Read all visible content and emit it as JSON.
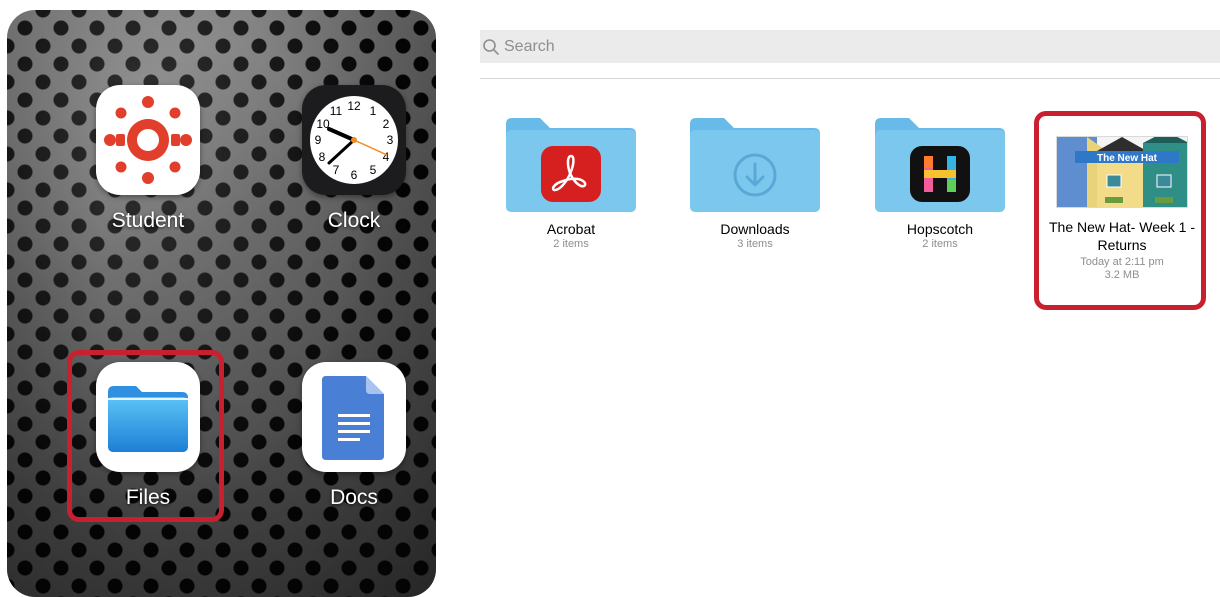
{
  "home": {
    "apps": [
      {
        "label": "Student",
        "icon": "canvas-student-icon"
      },
      {
        "label": "Clock",
        "icon": "clock-icon"
      },
      {
        "label": "Files",
        "icon": "files-folder-icon"
      },
      {
        "label": "Docs",
        "icon": "google-docs-icon"
      }
    ],
    "clock_numbers": [
      "12",
      "1",
      "2",
      "3",
      "4",
      "5",
      "6",
      "7",
      "8",
      "9",
      "10",
      "11"
    ]
  },
  "search": {
    "placeholder": "Search"
  },
  "files": {
    "items": [
      {
        "name": "Acrobat",
        "meta": "2 items",
        "icon": "acrobat-icon"
      },
      {
        "name": "Downloads",
        "meta": "3 items",
        "icon": "download-arrow-icon"
      },
      {
        "name": "Hopscotch",
        "meta": "2 items",
        "icon": "hopscotch-icon"
      },
      {
        "name": "The New Hat- Week 1 - Returns",
        "meta": "Today at 2:11 pm",
        "size": "3.2 MB",
        "thumb_title": "The New Hat"
      }
    ]
  },
  "colors": {
    "highlight": "#c8202f",
    "folder": "#7cc7ee",
    "canvas_red": "#e13f2b",
    "acrobat_red": "#d61f1f"
  }
}
